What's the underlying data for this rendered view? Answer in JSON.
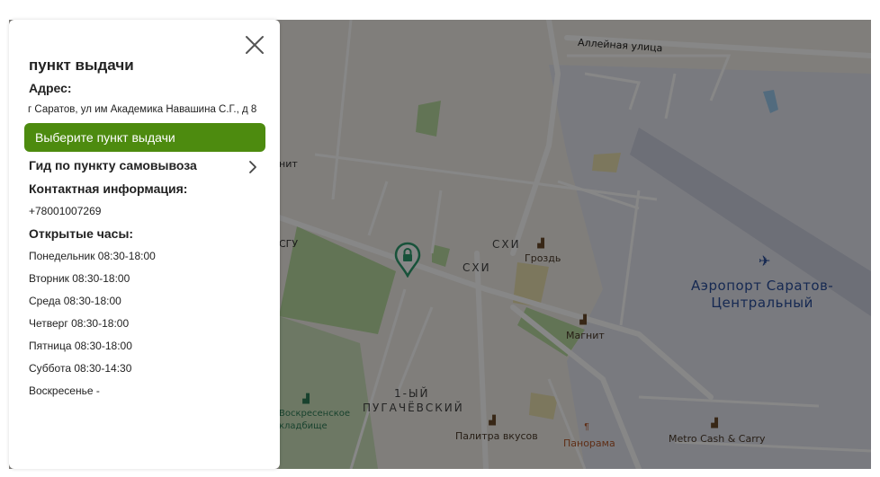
{
  "panel": {
    "title": "пункт выдачи",
    "address_label": "Адрес:",
    "address": "г Саратов, ул им Академика Навашина С.Г., д 8",
    "select_button": "Выберите пункт выдачи",
    "guide_link": "Гид по пункту самовывоза",
    "contact_label": "Контактная информация:",
    "phone": "+78001007269",
    "hours_label": "Открытые часы:",
    "hours": [
      "Понедельник 08:30-18:00",
      "Вторник 08:30-18:00",
      "Среда 08:30-18:00",
      "Четверг 08:30-18:00",
      "Пятница 08:30-18:00",
      "Суббота 08:30-14:30",
      "Воскресенье -"
    ],
    "accent_color": "#4d8b0f",
    "close_icon": "close-icon",
    "chevron_icon": "chevron-right-icon"
  },
  "map": {
    "labels": {
      "alleynaya": "Аллейная улица",
      "nit": "нит",
      "sgu": "СГУ",
      "shi_1": "СХИ",
      "shi_2": "СХИ",
      "grozd": "Гроздь",
      "magnit": "Магнит",
      "district_1": "1-ЫЙ",
      "district_2": "ПУГАЧЁВСКИЙ",
      "cemetery_1": "Воскресенское",
      "cemetery_2": "кладбище",
      "palitra": "Палитра вкусов",
      "panorama": "Панорама",
      "metro": "Metro Cash & Carry",
      "airport_1": "Аэропорт Саратов-",
      "airport_2": "Центральный"
    },
    "marker_icon": "lock-pin-icon",
    "airport_icon": "airplane-icon"
  }
}
